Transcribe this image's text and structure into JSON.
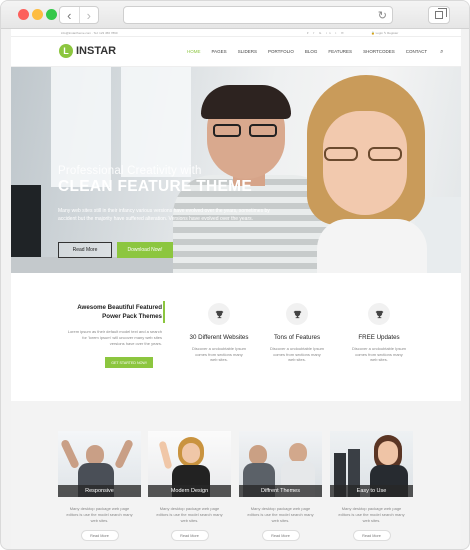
{
  "browser": {
    "nav_back": "‹",
    "nav_forward": "›",
    "reload_icon": "↻",
    "traffic_colors": [
      "#fc605c",
      "#fdbc40",
      "#34c84a"
    ]
  },
  "topbar": {
    "contact": "info@instartheme.com  ·  Tel: 123 456 7890",
    "social": "▾ f G in t ✉",
    "links": "🔒 Login   ✎ Register"
  },
  "header": {
    "logo_mark": "L",
    "logo_text": "INSTAR",
    "menu": [
      "HOME",
      "PAGES",
      "SLIDERS",
      "PORTFOLIO",
      "BLOG",
      "FEATURES",
      "SHORTCODES",
      "CONTACT"
    ],
    "active_index": 0,
    "search_icon": "⌕"
  },
  "hero": {
    "subtitle": "Professional Creativity with",
    "title": "CLEAN FEATURE THEME",
    "text": "Many web sites still in their infancy various versions have evolved over the years, sometimes by accident but the majority have suffered alteration. Versions have evolved over the years.",
    "read_more": "Read More",
    "download": "Download Now!"
  },
  "features": {
    "left_title": "Awesome Beautiful Featured Power Pack Themes",
    "left_text": "Lorem ipsum as their default model text and a search for 'lorem ipsum' will uncover many web sites versions have over the years.",
    "start_button": "GET STARTED NOW!",
    "items": [
      {
        "name": "30 Different Websites",
        "desc": "Discover a undoubtable Ipsum comes from sections many web sites."
      },
      {
        "name": "Tons of Features",
        "desc": "Discover a undoubtable Ipsum comes from sections many web sites."
      },
      {
        "name": "FREE Updates",
        "desc": "Discover a undoubtable Ipsum comes from sections many web sites."
      }
    ]
  },
  "cards": [
    {
      "label": "Responsive",
      "text": "Many desktop package web page editors is use the model search many web sites.",
      "button": "Read More"
    },
    {
      "label": "Modern Design",
      "text": "Many desktop package web page editors is use the model search many web sites.",
      "button": "Read More"
    },
    {
      "label": "Diffrent Themes",
      "text": "Many desktop package web page editors is use the model search many web sites.",
      "button": "Read More"
    },
    {
      "label": "Easy to Use",
      "text": "Many desktop package web page editors is use the model search many web sites.",
      "button": "Read More"
    }
  ],
  "colors": {
    "accent": "#8cc63f",
    "text_dark": "#222222",
    "text_muted": "#888888"
  }
}
